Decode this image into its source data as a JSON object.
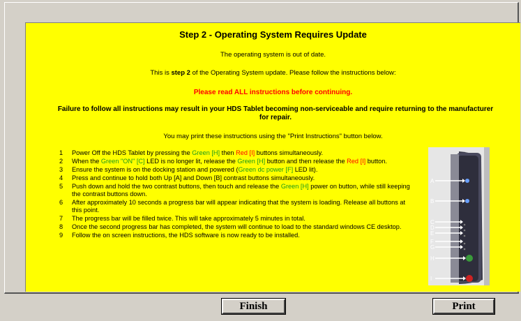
{
  "panel": {
    "title": "Step 2 - Operating System Requires Update",
    "line1": "The operating system is out of date.",
    "line2_pre": "This is ",
    "line2_bold": "step 2",
    "line2_post": " of the Operating System update. Please follow the instructions below:",
    "warning": "Please read ALL instructions before continuing.",
    "failure": "Failure to follow all instructions may result in your HDS Tablet becoming non-serviceable and require returning to the manufacturer for repair.",
    "print_note": "You may print these instructions using the \"Print Instructions\" button below."
  },
  "steps": [
    {
      "num": "1",
      "parts": [
        [
          "",
          "Power Off the HDS Tablet by pressing the "
        ],
        [
          "g",
          "Green [H]"
        ],
        [
          "",
          " then "
        ],
        [
          "r",
          "Red [I]"
        ],
        [
          "",
          " buttons simultaneously."
        ]
      ]
    },
    {
      "num": "2",
      "parts": [
        [
          "",
          "When the "
        ],
        [
          "g",
          "Green \"ON\" [C]"
        ],
        [
          "",
          " LED is no longer lit, release the "
        ],
        [
          "g",
          "Green [H]"
        ],
        [
          "",
          " button and then release the "
        ],
        [
          "r",
          "Red [I]"
        ],
        [
          "",
          " button."
        ]
      ]
    },
    {
      "num": "3",
      "parts": [
        [
          "",
          "Ensure the system is on the docking station and powered ("
        ],
        [
          "g",
          "Green dc power [F]"
        ],
        [
          "",
          " LED lit)."
        ]
      ]
    },
    {
      "num": "4",
      "parts": [
        [
          "",
          "Press and continue to hold both Up [A] and Down [B] contrast buttons simultaneously."
        ]
      ]
    },
    {
      "num": "5",
      "parts": [
        [
          "",
          "Push down and hold the two contrast buttons, then touch and release the "
        ],
        [
          "g",
          "Green [H]"
        ],
        [
          "",
          " power on button, while still keeping the contrast buttons down."
        ]
      ]
    },
    {
      "num": "6",
      "parts": [
        [
          "",
          "After approximately 10 seconds a progress bar will appear indicating that the system is loading. Release all buttons at this point."
        ]
      ]
    },
    {
      "num": "7",
      "parts": [
        [
          "",
          "The progress bar will be filled twice.  This will take approximately 5 minutes in total."
        ]
      ]
    },
    {
      "num": "8",
      "parts": [
        [
          "",
          "Once the second progress bar has completed, the system will continue to load to the standard windows CE desktop."
        ]
      ]
    },
    {
      "num": "9",
      "parts": [
        [
          "",
          "Follow the on screen instructions, the HDS software is now ready to be installed."
        ]
      ]
    }
  ],
  "device_labels": [
    "A",
    "B",
    "C",
    "D",
    "E",
    "F",
    "G",
    "H",
    "I"
  ],
  "buttons": {
    "finish": "Finish",
    "print": "Print"
  },
  "colors": {
    "panel_bg": "#ffff00",
    "green_text": "#1a9a1a",
    "red_text": "#ff0000"
  }
}
